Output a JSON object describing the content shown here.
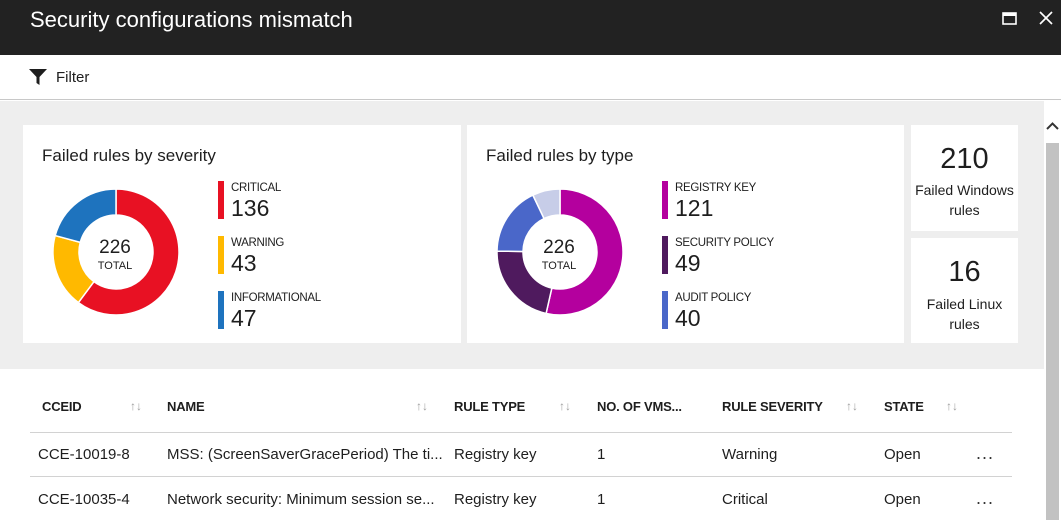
{
  "window": {
    "title": "Security configurations mismatch",
    "maximize_icon": "maximize-icon",
    "close_icon": "close-icon"
  },
  "toolbar": {
    "filter_label": "Filter",
    "filter_icon": "funnel-icon"
  },
  "severity_card": {
    "title": "Failed rules by severity",
    "total": "226",
    "total_label": "TOTAL",
    "items": [
      {
        "label": "CRITICAL",
        "value": "136",
        "color": "#e81123"
      },
      {
        "label": "WARNING",
        "value": "43",
        "color": "#ffb900"
      },
      {
        "label": "INFORMATIONAL",
        "value": "47",
        "color": "#1e73be"
      }
    ]
  },
  "type_card": {
    "title": "Failed rules by type",
    "total": "226",
    "total_label": "TOTAL",
    "items": [
      {
        "label": "REGISTRY KEY",
        "value": "121",
        "color": "#b4009e"
      },
      {
        "label": "SECURITY POLICY",
        "value": "49",
        "color": "#4f1a5e"
      },
      {
        "label": "AUDIT POLICY",
        "value": "40",
        "color": "#4a67c9"
      }
    ],
    "other_color": "#c7cde8"
  },
  "windows_card": {
    "value": "210",
    "label_line1": "Failed Windows",
    "label_line2": "rules"
  },
  "linux_card": {
    "value": "16",
    "label_line1": "Failed Linux",
    "label_line2": "rules"
  },
  "table": {
    "columns": [
      "CCEID",
      "NAME",
      "RULE TYPE",
      "NO. OF VMS...",
      "RULE SEVERITY",
      "STATE"
    ],
    "sort_icon": "↑↓",
    "rows": [
      [
        "CCE-10019-8",
        "MSS: (ScreenSaverGracePeriod) The ti...",
        "Registry key",
        "1",
        "Warning",
        "Open"
      ],
      [
        "CCE-10035-4",
        "Network security: Minimum session se...",
        "Registry key",
        "1",
        "Critical",
        "Open"
      ]
    ],
    "more_label": "...",
    "more_icon": "more-options-icon"
  },
  "chart_data": [
    {
      "type": "pie",
      "title": "Failed rules by severity",
      "categories": [
        "CRITICAL",
        "WARNING",
        "INFORMATIONAL"
      ],
      "values": [
        136,
        43,
        47
      ],
      "colors": [
        "#e81123",
        "#ffb900",
        "#1e73be"
      ],
      "total": 226
    },
    {
      "type": "pie",
      "title": "Failed rules by type",
      "categories": [
        "REGISTRY KEY",
        "SECURITY POLICY",
        "AUDIT POLICY",
        ""
      ],
      "values": [
        121,
        49,
        40,
        16
      ],
      "colors": [
        "#b4009e",
        "#4f1a5e",
        "#4a67c9",
        "#c7cde8"
      ],
      "total": 226
    }
  ]
}
